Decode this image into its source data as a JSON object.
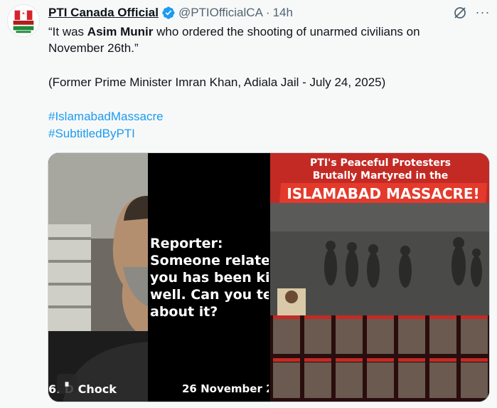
{
  "author": {
    "name": "PTI Canada Official",
    "handle": "@PTIOfficialCA",
    "separator": "·",
    "time": "14h"
  },
  "icons": {
    "avatar": "pti-canada-logo",
    "verified": "verified-badge-icon",
    "grok": "grok-icon",
    "more": "more-options-icon",
    "play": "pause-icon"
  },
  "colors": {
    "link": "#1d9bf0",
    "verified": "#1d9bf0",
    "poster_red": "#c42a24"
  },
  "tweet": {
    "line1_a": "“It was ",
    "line1_bold": "Asim Munir",
    "line1_b": " who ordered the shooting of unarmed civilians on",
    "line2": "November 26th.”",
    "line3": "(Former Prime Minister Imran Khan, Adiala Jail - July 24, 2025)",
    "hashtag1": "#IslamabadMassacre",
    "hashtag2": "#SubtitledByPTI"
  },
  "video": {
    "subtitle": "Reporter:\nSomeone relate\nyou has been kil\nwell. Can you tel\nabout it?",
    "caption_left": "6. D Chock",
    "caption_right": "26 November 2",
    "play_glyph": "⏸"
  },
  "poster": {
    "title_line1": "PTI's Peaceful Protesters",
    "title_line2": "Brutally Martyred in the",
    "title_line3": "ISLAMABAD MASSACRE!"
  }
}
